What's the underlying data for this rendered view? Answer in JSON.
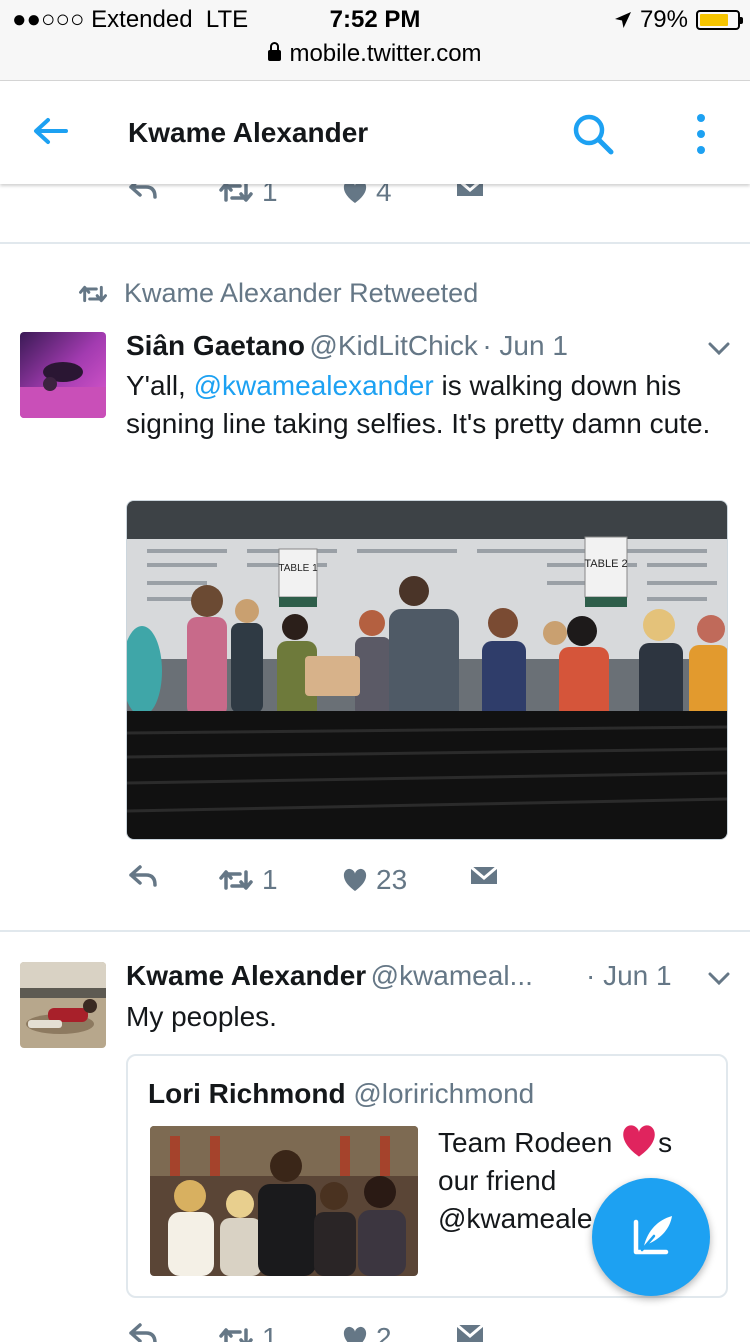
{
  "status": {
    "carrier": "●●○○○ Extended",
    "network": "LTE",
    "time": "7:52 PM",
    "battery": "79%",
    "battery_level": 0.79,
    "url": "mobile.twitter.com"
  },
  "header": {
    "title": "Kwame Alexander"
  },
  "top_actions": {
    "retweets": "1",
    "likes": "4"
  },
  "retweet_notice": "Kwame Alexander Retweeted",
  "tweet1": {
    "name": "Siân Gaetano",
    "handle": "@KidLitChick",
    "date": "· Jun 1",
    "text_before": "Y'all, ",
    "mention": "@kwamealexander",
    "text_after": " is walking down his signing line taking selfies. It's pretty damn cute.",
    "table1_sign": "TABLE 1",
    "table2_sign": "TABLE 2",
    "retweets": "1",
    "likes": "23"
  },
  "tweet2": {
    "name": "Kwame Alexander",
    "handle": "@kwameal...",
    "date": "· Jun 1",
    "text": "My peoples.",
    "quote": {
      "name": "Lori Richmond",
      "handle": "@loririchmond",
      "text_before": "Team Rodeen ",
      "text_after": "s our friend @kwameale"
    },
    "retweets": "1",
    "likes": "2"
  },
  "colors": {
    "accent": "#1da1f2",
    "muted": "#657786",
    "heart": "#e0245e"
  }
}
